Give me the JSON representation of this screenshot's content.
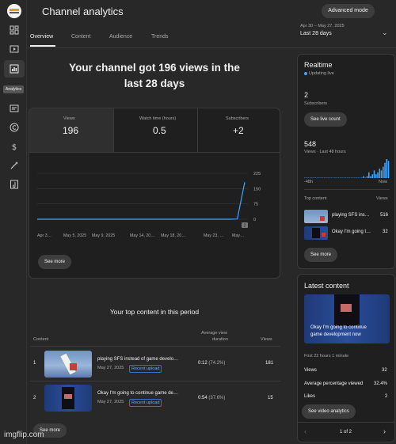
{
  "header": {
    "title": "Channel analytics",
    "advanced_mode": "Advanced mode",
    "tabs": [
      "Overview",
      "Content",
      "Audience",
      "Trends"
    ],
    "range_sub": "Apr 30 – May 27, 2025",
    "range_main": "Last 28 days",
    "rail_tooltip": "Analytics"
  },
  "summary": {
    "headline_line1": "Your channel got 196 views in the",
    "headline_line2": "last 28 days",
    "metrics": [
      {
        "label": "Views",
        "value": "196"
      },
      {
        "label": "Watch time (hours)",
        "value": "0.5"
      },
      {
        "label": "Subscribers",
        "value": "+2"
      }
    ],
    "see_more": "See more"
  },
  "chart_data": {
    "type": "line",
    "x": [
      "Apr 3…",
      "May 5, 2025",
      "May 9, 2025",
      "May 14, 20…",
      "May 18, 20…",
      "May 23, …",
      "May…"
    ],
    "y_ticks": [
      "225",
      "150",
      "75",
      "0"
    ],
    "ylim": [
      0,
      225
    ],
    "series": [
      {
        "values": [
          0,
          0,
          0,
          0,
          0,
          0,
          0,
          0,
          0,
          0,
          0,
          0,
          0,
          0,
          0,
          0,
          0,
          0,
          0,
          0,
          0,
          0,
          0,
          0,
          0,
          0,
          0,
          1,
          181
        ]
      }
    ],
    "end_marker": "2",
    "color": "#3ea6ff"
  },
  "top_content": {
    "title": "Your top content in this period",
    "col_content": "Content",
    "col_avd_line1": "Average view",
    "col_avd_line2": "duration",
    "col_views": "Views",
    "rows": [
      {
        "rank": "1",
        "title": "playing SFS instead of game develo…",
        "date": "May 27, 2025",
        "badge": "Recent upload",
        "duration": "0:12",
        "pct": "(74.2%)",
        "views": "181"
      },
      {
        "rank": "2",
        "title": "Okay I'm going to continue game de…",
        "date": "May 27, 2025",
        "badge": "Recent upload",
        "duration": "0:54",
        "pct": "(37.6%)",
        "views": "15"
      }
    ],
    "see_more": "See more"
  },
  "realtime": {
    "title": "Realtime",
    "status": "Updating live",
    "subs_value": "2",
    "subs_label": "Subscribers",
    "live_count_button": "See live count",
    "views_value": "548",
    "views_label": "Views · Last 48 hours",
    "bars": [
      0,
      0,
      0,
      0,
      0,
      0,
      0,
      0,
      0,
      0,
      0,
      0,
      0,
      0,
      0,
      0,
      0,
      0,
      0,
      0,
      0,
      0,
      0,
      0,
      0,
      0,
      0,
      0,
      0,
      0,
      0,
      0,
      0,
      1,
      0,
      1,
      3,
      1,
      2,
      4,
      2,
      3,
      5,
      4,
      6,
      8,
      10,
      9
    ],
    "axis_left": "-48h",
    "axis_right": "Now",
    "top_content_label": "Top content",
    "views_col": "Views",
    "items": [
      {
        "title": "playing SFS ins…",
        "views": "516"
      },
      {
        "title": "Okay I'm going t…",
        "views": "32"
      }
    ],
    "see_more": "See more"
  },
  "latest": {
    "title": "Latest content",
    "thumb_caption_line1": "Okay I'm going to continue",
    "thumb_caption_line2": "game development now",
    "first_period": "First 22 hours 1 minute",
    "rows": [
      {
        "label": "Views",
        "value": "32"
      },
      {
        "label": "Average percentage viewed",
        "value": "32.4%"
      },
      {
        "label": "Likes",
        "value": "2"
      }
    ],
    "video_analytics_button": "See video analytics",
    "pager": "1 of 2"
  },
  "watermark": "imgflip.com"
}
